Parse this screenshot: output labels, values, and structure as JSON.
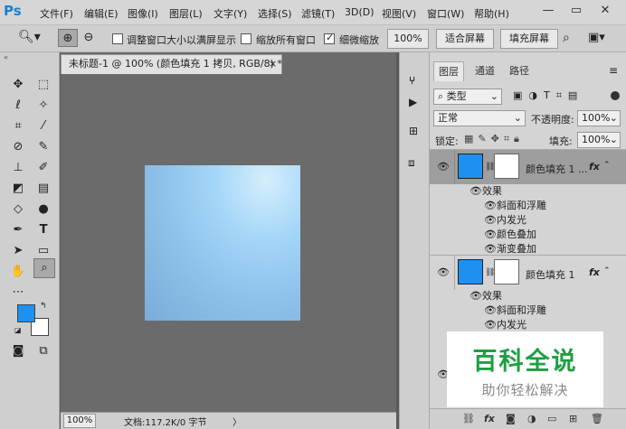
{
  "app": {
    "logo": "Ps"
  },
  "menu": [
    "文件(F)",
    "编辑(E)",
    "图像(I)",
    "图层(L)",
    "文字(Y)",
    "选择(S)",
    "滤镜(T)",
    "3D(D)",
    "视图(V)",
    "窗口(W)",
    "帮助(H)"
  ],
  "window": {
    "minimize": "—",
    "restore": "▭",
    "close": "✕"
  },
  "options": {
    "resize_windows": "调整窗口大小以满屏显示",
    "zoom_all": "缩放所有窗口",
    "scrubby": "细微缩放",
    "zoom_value": "100%",
    "fit_screen": "适合屏幕",
    "fill_screen": "填充屏幕"
  },
  "document": {
    "tab_title": "未标题-1 @ 100% (颜色填充 1 拷贝, RGB/8) *",
    "tab_close": "×"
  },
  "status": {
    "zoom": "100%",
    "doc_info": "文档:117.2K/0 字节",
    "arrow": "〉"
  },
  "panel": {
    "tabs": [
      "图层",
      "通道",
      "路径"
    ],
    "kind_label": "类型",
    "blend_mode": "正常",
    "opacity_label": "不透明度:",
    "opacity_value": "100%",
    "lock_label": "锁定:",
    "fill_label": "填充:",
    "fill_value": "100%"
  },
  "layers": [
    {
      "name": "颜色填充 1 ...",
      "fx": "fx",
      "effects_label": "效果",
      "effects": [
        "斜面和浮雕",
        "内发光",
        "颜色叠加",
        "渐变叠加"
      ]
    },
    {
      "name": "颜色填充 1",
      "fx": "fx",
      "effects_label": "效果",
      "effects": [
        "斜面和浮雕",
        "内发光"
      ]
    }
  ],
  "watermark": {
    "title": "百科全说",
    "subtitle": "助你轻松解决"
  },
  "colors": {
    "foreground": "#1e90f0",
    "background": "#ffffff",
    "canvas": "#8ec2ea"
  }
}
